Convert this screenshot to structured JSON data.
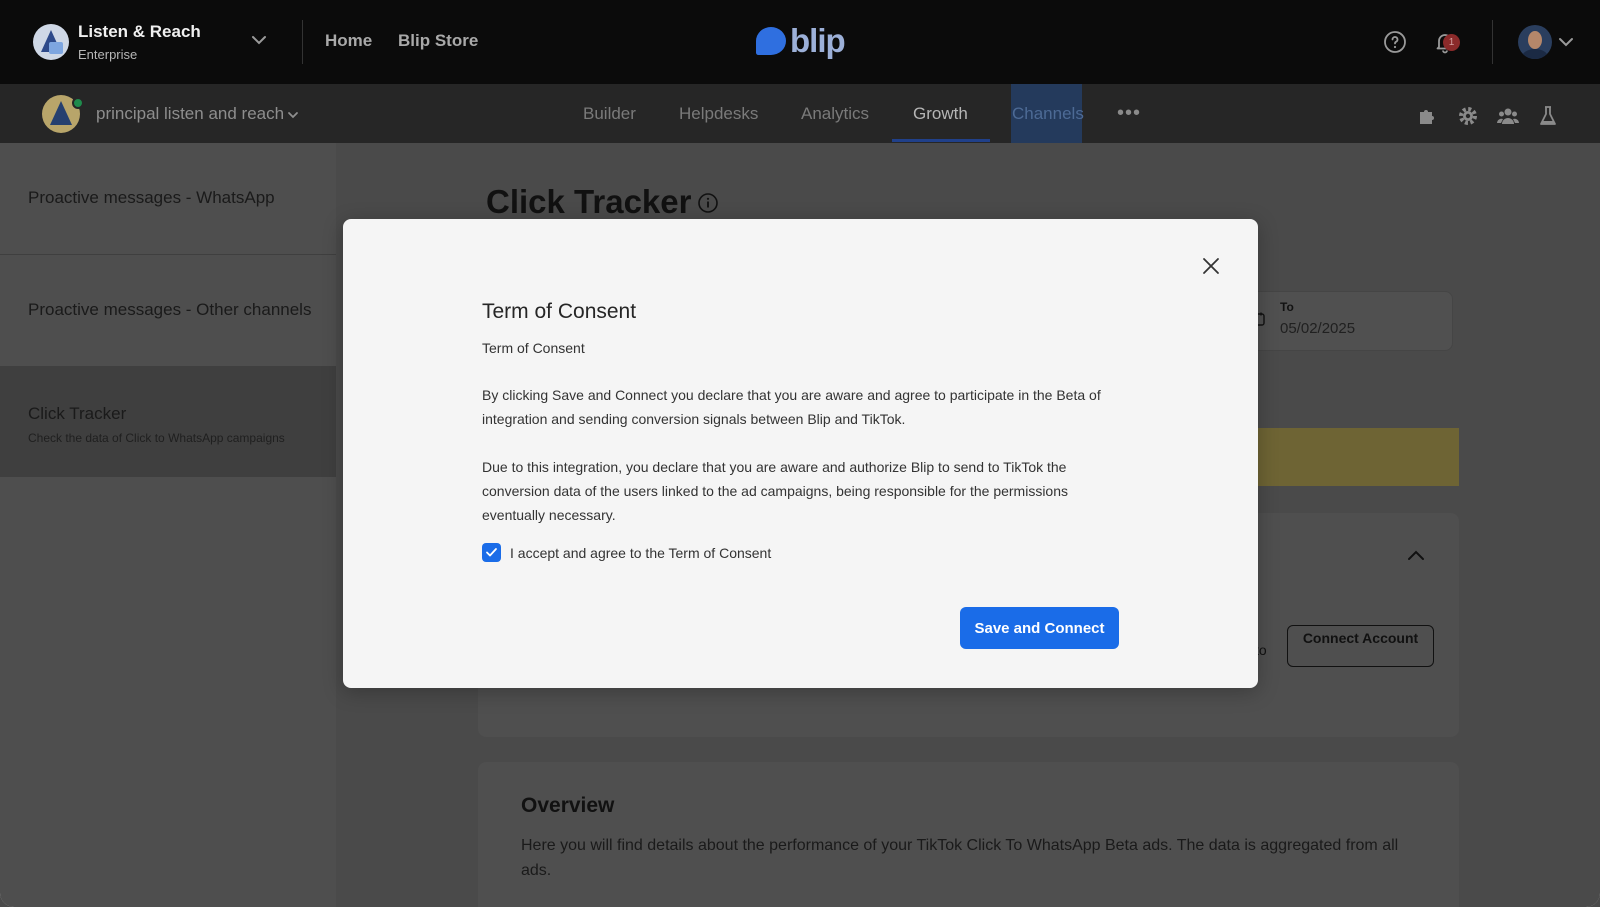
{
  "topbar": {
    "org_name": "Listen & Reach",
    "org_plan": "Enterprise",
    "nav": [
      {
        "label": "Home"
      },
      {
        "label": "Blip Store"
      }
    ],
    "logo_text": "blip",
    "notification_count": "1",
    "icons": [
      "help-icon",
      "bell-icon",
      "chevron-down-icon"
    ]
  },
  "subbar": {
    "bot_name": "principal listen and reach",
    "tabs": [
      {
        "label": "Builder"
      },
      {
        "label": "Helpdesks"
      },
      {
        "label": "Analytics"
      },
      {
        "label": "Growth",
        "active": true
      },
      {
        "label": "Channels"
      }
    ],
    "more_label": "•••",
    "icons": [
      "puzzle-icon",
      "gear-icon",
      "team-icon",
      "flask-icon"
    ]
  },
  "sidebar": {
    "items": [
      {
        "title": "Proactive messages - WhatsApp",
        "subtitle": ""
      },
      {
        "title": "Proactive messages - Other channels",
        "subtitle": ""
      },
      {
        "title": "Click Tracker",
        "subtitle": "Check the data of Click to WhatsApp campaigns",
        "active": true
      }
    ]
  },
  "main": {
    "page_title": "Click Tracker",
    "date_to_label": "To",
    "date_to_value": "05/02/2025",
    "connect_button": "Connect Account",
    "to_text": "to",
    "overview_title": "Overview",
    "overview_text": "Here you will find details about the performance of your TikTok Click To WhatsApp Beta ads. The data is aggregated from all ads."
  },
  "modal": {
    "title": "Term of Consent",
    "subtitle": "Term of Consent",
    "paragraph1": "By clicking Save and Connect you declare that you are aware and agree to participate in the Beta of integration and sending conversion signals between Blip and TikTok.",
    "paragraph2": "Due to this integration, you declare that you are aware and authorize Blip to send to TikTok the conversion data of the users linked to the ad campaigns, being responsible for the permissions eventually necessary.",
    "checkbox_label": "I accept and agree to the Term of Consent",
    "checkbox_checked": true,
    "primary_button": "Save and Connect"
  },
  "colors": {
    "accent": "#1a6ce8",
    "topbar_bg": "#0b0b0b",
    "modal_bg": "#f5f5f5"
  }
}
